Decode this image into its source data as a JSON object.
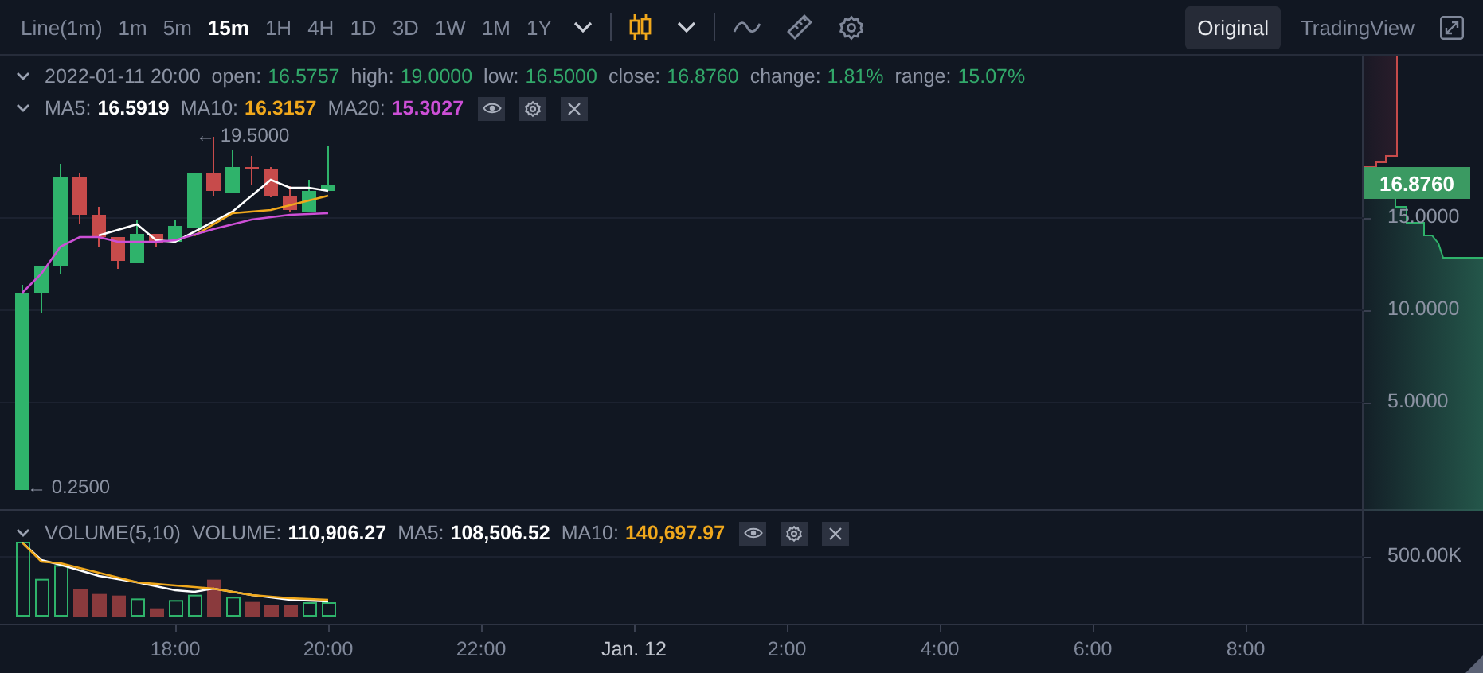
{
  "toolbar": {
    "intervals": [
      {
        "label": "Line(1m)",
        "selected": false
      },
      {
        "label": "1m",
        "selected": false
      },
      {
        "label": "5m",
        "selected": false
      },
      {
        "label": "15m",
        "selected": true
      },
      {
        "label": "1H",
        "selected": false
      },
      {
        "label": "4H",
        "selected": false
      },
      {
        "label": "1D",
        "selected": false
      },
      {
        "label": "3D",
        "selected": false
      },
      {
        "label": "1W",
        "selected": false
      },
      {
        "label": "1M",
        "selected": false
      },
      {
        "label": "1Y",
        "selected": false
      }
    ],
    "view_modes": [
      {
        "label": "Original",
        "selected": true
      },
      {
        "label": "TradingView",
        "selected": false
      }
    ]
  },
  "legend": {
    "date": "2022-01-11 20:00",
    "fields": [
      {
        "label": "open:",
        "value": "16.5757"
      },
      {
        "label": "high:",
        "value": "19.0000"
      },
      {
        "label": "low:",
        "value": "16.5000"
      },
      {
        "label": "close:",
        "value": "16.8760"
      },
      {
        "label": "change:",
        "value": "1.81%"
      },
      {
        "label": "range:",
        "value": "15.07%"
      }
    ],
    "moving_averages": [
      {
        "label": "MA5:",
        "value": "16.5919",
        "color": "#ffffff"
      },
      {
        "label": "MA10:",
        "value": "16.3157",
        "color": "#f0a81c"
      },
      {
        "label": "MA20:",
        "value": "15.3027",
        "color": "#cc4fd6"
      }
    ]
  },
  "price_chart": {
    "high_marker": "← 19.5000",
    "low_marker": "← 0.2500"
  },
  "price_axis": {
    "labels": [
      "15.0000",
      "10.0000",
      "5.0000"
    ],
    "current_price": "16.8760"
  },
  "volume_legend": {
    "title": "VOLUME(5,10)",
    "items": [
      {
        "label": "VOLUME:",
        "value": "110,906.27",
        "color": "#ffffff"
      },
      {
        "label": "MA5:",
        "value": "108,506.52",
        "color": "#ffffff"
      },
      {
        "label": "MA10:",
        "value": "140,697.97",
        "color": "#f0a81c"
      }
    ]
  },
  "volume_axis": {
    "labels": [
      "500.00K"
    ]
  },
  "time_axis": {
    "labels": [
      {
        "text": "18:00",
        "emphasized": false
      },
      {
        "text": "20:00",
        "emphasized": false
      },
      {
        "text": "22:00",
        "emphasized": false
      },
      {
        "text": "Jan. 12",
        "emphasized": true
      },
      {
        "text": "2:00",
        "emphasized": false
      },
      {
        "text": "4:00",
        "emphasized": false
      },
      {
        "text": "6:00",
        "emphasized": false
      },
      {
        "text": "8:00",
        "emphasized": false
      }
    ]
  }
}
